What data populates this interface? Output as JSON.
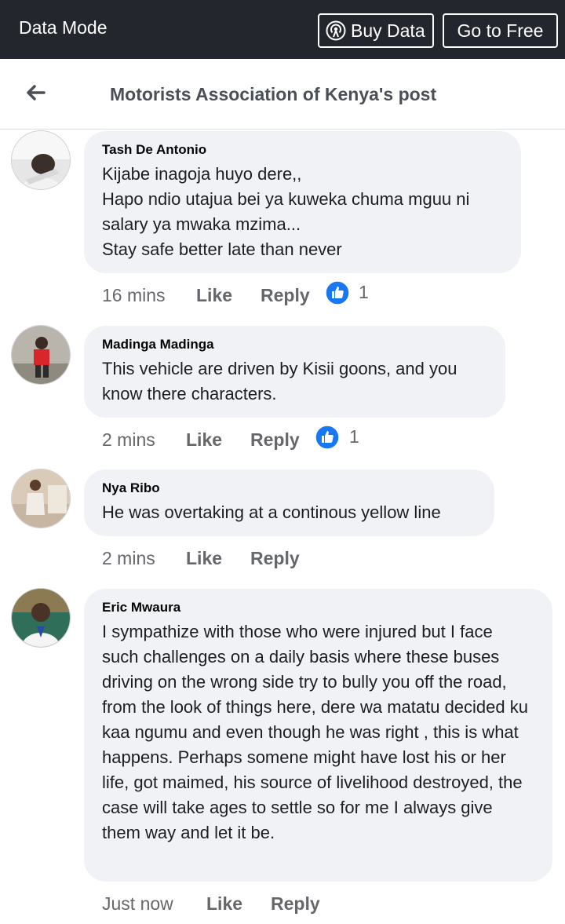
{
  "topbar": {
    "mode_label": "Data Mode",
    "buy_data_label": "Buy Data",
    "go_free_label": "Go to Free"
  },
  "header": {
    "title": "Motorists Association of Kenya's post"
  },
  "comments": [
    {
      "author": "Tash De Antonio",
      "text": "Kijabe inagoja huyo dere,,\nHapo ndio utajua bei ya kuweka chuma mguu ni salary ya mwaka mzima...\nStay safe better late than never",
      "time": "16 mins",
      "like_label": "Like",
      "reply_label": "Reply",
      "reaction_count": "1"
    },
    {
      "author": "Madinga Madinga",
      "text": "This vehicle are driven by Kisii goons, and you know there characters.",
      "time": "2 mins",
      "like_label": "Like",
      "reply_label": "Reply",
      "reaction_count": "1"
    },
    {
      "author": "Nya Ribo",
      "text": "He was overtaking at a continous yellow line",
      "time": "2 mins",
      "like_label": "Like",
      "reply_label": "Reply"
    },
    {
      "author": "Eric Mwaura",
      "text": "I sympathize with those who were injured but I face such challenges on a daily basis where these buses driving on the wrong side try to bully you off the road, from the look of things here, dere wa matatu decided ku kaa ngumu and even though he was right , this is what happens. Perhaps somene might have lost his or her life, got maimed, his source of livelihood destroyed, the case will take ages to settle so for me I always give them way and let it be.",
      "time": "Just now",
      "like_label": "Like",
      "reply_label": "Reply"
    }
  ],
  "icons": {
    "back": "back-arrow-icon",
    "buy_data": "broadcast-icon",
    "reaction": "thumbs-up-icon"
  },
  "colors": {
    "topbar_bg": "#23272d",
    "bubble_bg": "#f0f2f5",
    "like_blue": "#1877f2",
    "meta_gray": "#65676b"
  }
}
